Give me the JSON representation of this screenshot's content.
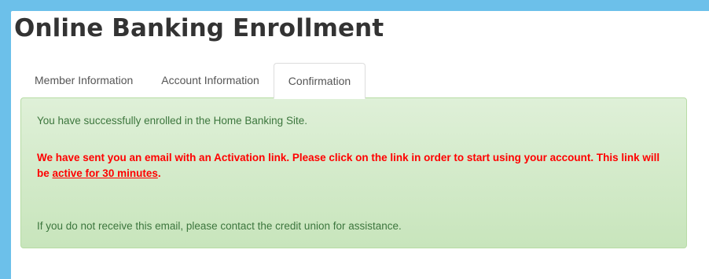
{
  "page": {
    "title": "Online Banking Enrollment"
  },
  "tabs": [
    {
      "label": "Member Information",
      "active": false
    },
    {
      "label": "Account Information",
      "active": false
    },
    {
      "label": "Confirmation",
      "active": true
    }
  ],
  "alert": {
    "success_message": "You have successfully enrolled in the Home Banking Site.",
    "activation_message": "We have sent you an email with an Activation link. Please click on the link in order to start using your account. This link will be",
    "activation_duration": "active for 30 minutes",
    "activation_period": ".",
    "assistance_message": "If you do not receive this email, please contact the credit union for assistance."
  },
  "colors": {
    "background": "#6cc0ea",
    "alert_background": "#dff0d8",
    "alert_text": "#3c763d",
    "warning_text": "#ff0000"
  }
}
